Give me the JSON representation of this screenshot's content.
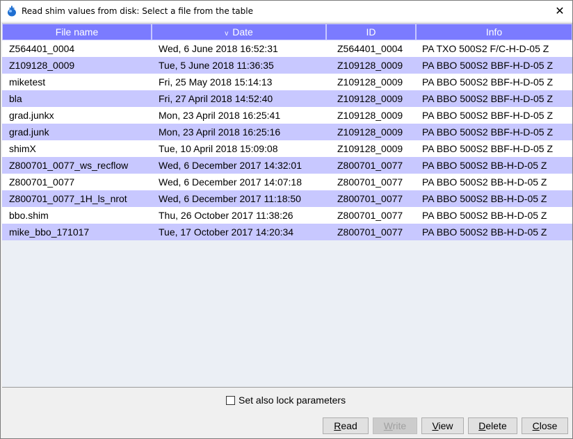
{
  "window": {
    "title": "Read shim values from disk: Select a file from the table",
    "close_symbol": "✕"
  },
  "table": {
    "columns": [
      {
        "label": "File name"
      },
      {
        "label": "Date",
        "sort_indicator": "v"
      },
      {
        "label": "ID"
      },
      {
        "label": "Info"
      }
    ],
    "rows": [
      [
        "Z564401_0004",
        "Wed, 6 June 2018 16:52:31",
        "Z564401_0004",
        "PA TXO 500S2 F/C-H-D-05 Z"
      ],
      [
        "Z109128_0009",
        "Tue, 5 June 2018 11:36:35",
        "Z109128_0009",
        "PA BBO 500S2 BBF-H-D-05 Z"
      ],
      [
        "miketest",
        "Fri, 25 May 2018 15:14:13",
        "Z109128_0009",
        "PA BBO 500S2 BBF-H-D-05 Z"
      ],
      [
        "bla",
        "Fri, 27 April 2018 14:52:40",
        "Z109128_0009",
        "PA BBO 500S2 BBF-H-D-05 Z"
      ],
      [
        "grad.junkx",
        "Mon, 23 April 2018 16:25:41",
        "Z109128_0009",
        "PA BBO 500S2 BBF-H-D-05 Z"
      ],
      [
        "grad.junk",
        "Mon, 23 April 2018 16:25:16",
        "Z109128_0009",
        "PA BBO 500S2 BBF-H-D-05 Z"
      ],
      [
        "shimX",
        "Tue, 10 April 2018 15:09:08",
        "Z109128_0009",
        "PA BBO 500S2 BBF-H-D-05 Z"
      ],
      [
        "Z800701_0077_ws_recflow",
        "Wed, 6 December 2017 14:32:01",
        "Z800701_0077",
        "PA BBO 500S2 BB-H-D-05 Z"
      ],
      [
        "Z800701_0077",
        "Wed, 6 December 2017 14:07:18",
        "Z800701_0077",
        "PA BBO 500S2 BB-H-D-05 Z"
      ],
      [
        "Z800701_0077_1H_ls_nrot",
        "Wed, 6 December 2017 11:18:50",
        "Z800701_0077",
        "PA BBO 500S2 BB-H-D-05 Z"
      ],
      [
        "bbo.shim",
        "Thu, 26 October 2017 11:38:26",
        "Z800701_0077",
        "PA BBO 500S2 BB-H-D-05 Z"
      ],
      [
        "mike_bbo_171017",
        "Tue, 17 October 2017 14:20:34",
        "Z800701_0077",
        "PA BBO 500S2 BB-H-D-05 Z"
      ]
    ]
  },
  "options": {
    "lock_checkbox_label": "Set also lock parameters",
    "lock_checked": false
  },
  "buttons": {
    "read": {
      "label": "Read",
      "enabled": true
    },
    "write": {
      "label": "Write",
      "enabled": false
    },
    "view": {
      "label": "View",
      "enabled": true
    },
    "delete": {
      "label": "Delete",
      "enabled": true
    },
    "close": {
      "label": "Close",
      "enabled": true
    }
  },
  "colors": {
    "header_bg": "#7b7bff",
    "row_alt_bg": "#c8c8ff",
    "row_bg": "#ffffff",
    "table_empty_bg": "#ebeff5"
  }
}
